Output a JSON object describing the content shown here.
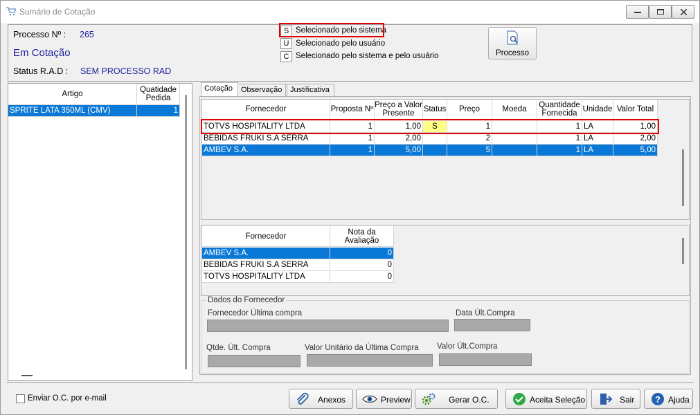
{
  "window": {
    "title": "Sumário de Cotação"
  },
  "header": {
    "process_label": "Processo Nº :",
    "process_value": "265",
    "status_text": "Em Cotação",
    "rad_label": "Status R.A.D :",
    "rad_value": "SEM PROCESSO RAD",
    "process_button": "Processo"
  },
  "legend": [
    {
      "code": "S",
      "text": "Selecionado pelo sistema"
    },
    {
      "code": "U",
      "text": "Selecionado pelo usuário"
    },
    {
      "code": "C",
      "text": "Selecionado pelo sistema e pelo usuário"
    }
  ],
  "left_table": {
    "headers": [
      "Artigo",
      "Quatidade Pedida"
    ],
    "rows": [
      {
        "artigo": "SPRITE LATA 350ML (CMV)",
        "qtd": "1"
      }
    ]
  },
  "tabs": [
    "Cotação",
    "Observação",
    "Justificativa"
  ],
  "quote_table": {
    "headers": [
      "Fornecedor",
      "Proposta Nº",
      "Preço a Valor Presente",
      "Status",
      "Preço",
      "Moeda",
      "Quantidade Fornecida",
      "Unidade",
      "Valor Total"
    ],
    "rows": [
      [
        "TOTVS HOSPITALITY LTDA",
        "1",
        "1,00",
        "S",
        "1",
        "",
        "1",
        "LA",
        "1,00"
      ],
      [
        "BEBIDAS FRUKI S.A SERRA",
        "1",
        "2,00",
        "",
        "2",
        "",
        "1",
        "LA",
        "2,00"
      ],
      [
        "AMBEV S.A.",
        "1",
        "5,00",
        "",
        "5",
        "",
        "1",
        "LA",
        "5,00"
      ]
    ]
  },
  "eval_table": {
    "headers": [
      "Fornecedor",
      "Nota da Avaliação"
    ],
    "rows": [
      [
        "AMBEV S.A.",
        "0"
      ],
      [
        "BEBIDAS FRUKI S.A SERRA",
        "0"
      ],
      [
        "TOTVS HOSPITALITY LTDA",
        "0"
      ]
    ]
  },
  "supplier_data": {
    "group_title": "Dados do Fornecedor",
    "last_supplier": "Fornecedor Última compra",
    "last_date": "Data Últ.Compra",
    "last_qty": "Qtde. Últ. Compra",
    "last_unit_value": "Valor Unitário da Última Compra",
    "last_value": "Valor Últ.Compra"
  },
  "footer": {
    "email_checkbox": "Enviar O.C. por e-mail",
    "email_checked": false,
    "buttons": [
      "Anexos",
      "Preview",
      "Gerar O.C.",
      "Aceita Seleção",
      "Sair",
      "Ajuda"
    ]
  },
  "colors": {
    "selection": "#0a78d7",
    "status_highlight": "#ffff88",
    "annotation_red": "#e00000"
  }
}
